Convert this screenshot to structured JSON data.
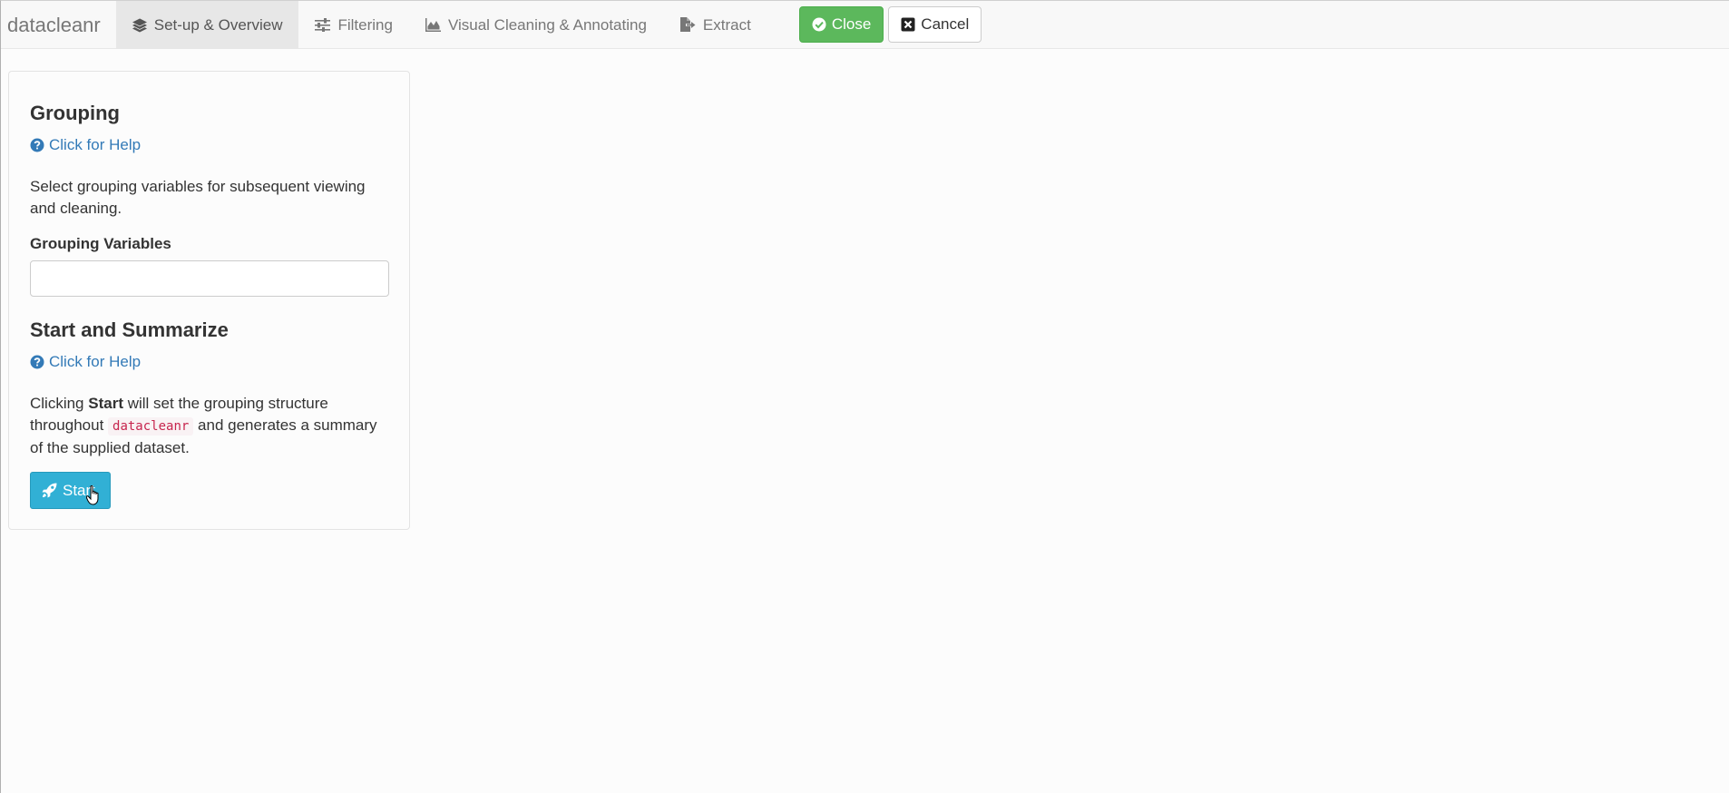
{
  "navbar": {
    "brand": "datacleanr",
    "tabs": [
      {
        "label": "Set-up & Overview",
        "icon": "layers-icon",
        "active": true
      },
      {
        "label": "Filtering",
        "icon": "sliders-icon",
        "active": false
      },
      {
        "label": "Visual Cleaning & Annotating",
        "icon": "area-chart-icon",
        "active": false
      },
      {
        "label": "Extract",
        "icon": "file-export-icon",
        "active": false
      }
    ],
    "close_label": "Close",
    "cancel_label": "Cancel"
  },
  "grouping": {
    "title": "Grouping",
    "help": "Click for Help",
    "description": "Select grouping variables for subsequent viewing and cleaning.",
    "field_label": "Grouping Variables",
    "field_value": ""
  },
  "start": {
    "title": "Start and Summarize",
    "help": "Click for Help",
    "desc_pre": "Clicking ",
    "desc_bold": "Start",
    "desc_mid": " will set the grouping structure throughout ",
    "desc_code": "datacleanr",
    "desc_post": " and generates a summary of the supplied dataset.",
    "button_label": "Start"
  },
  "colors": {
    "close_green": "#5cb85c",
    "start_blue": "#31b0d5",
    "link_blue": "#337ab7",
    "code_red": "#c7254e"
  }
}
